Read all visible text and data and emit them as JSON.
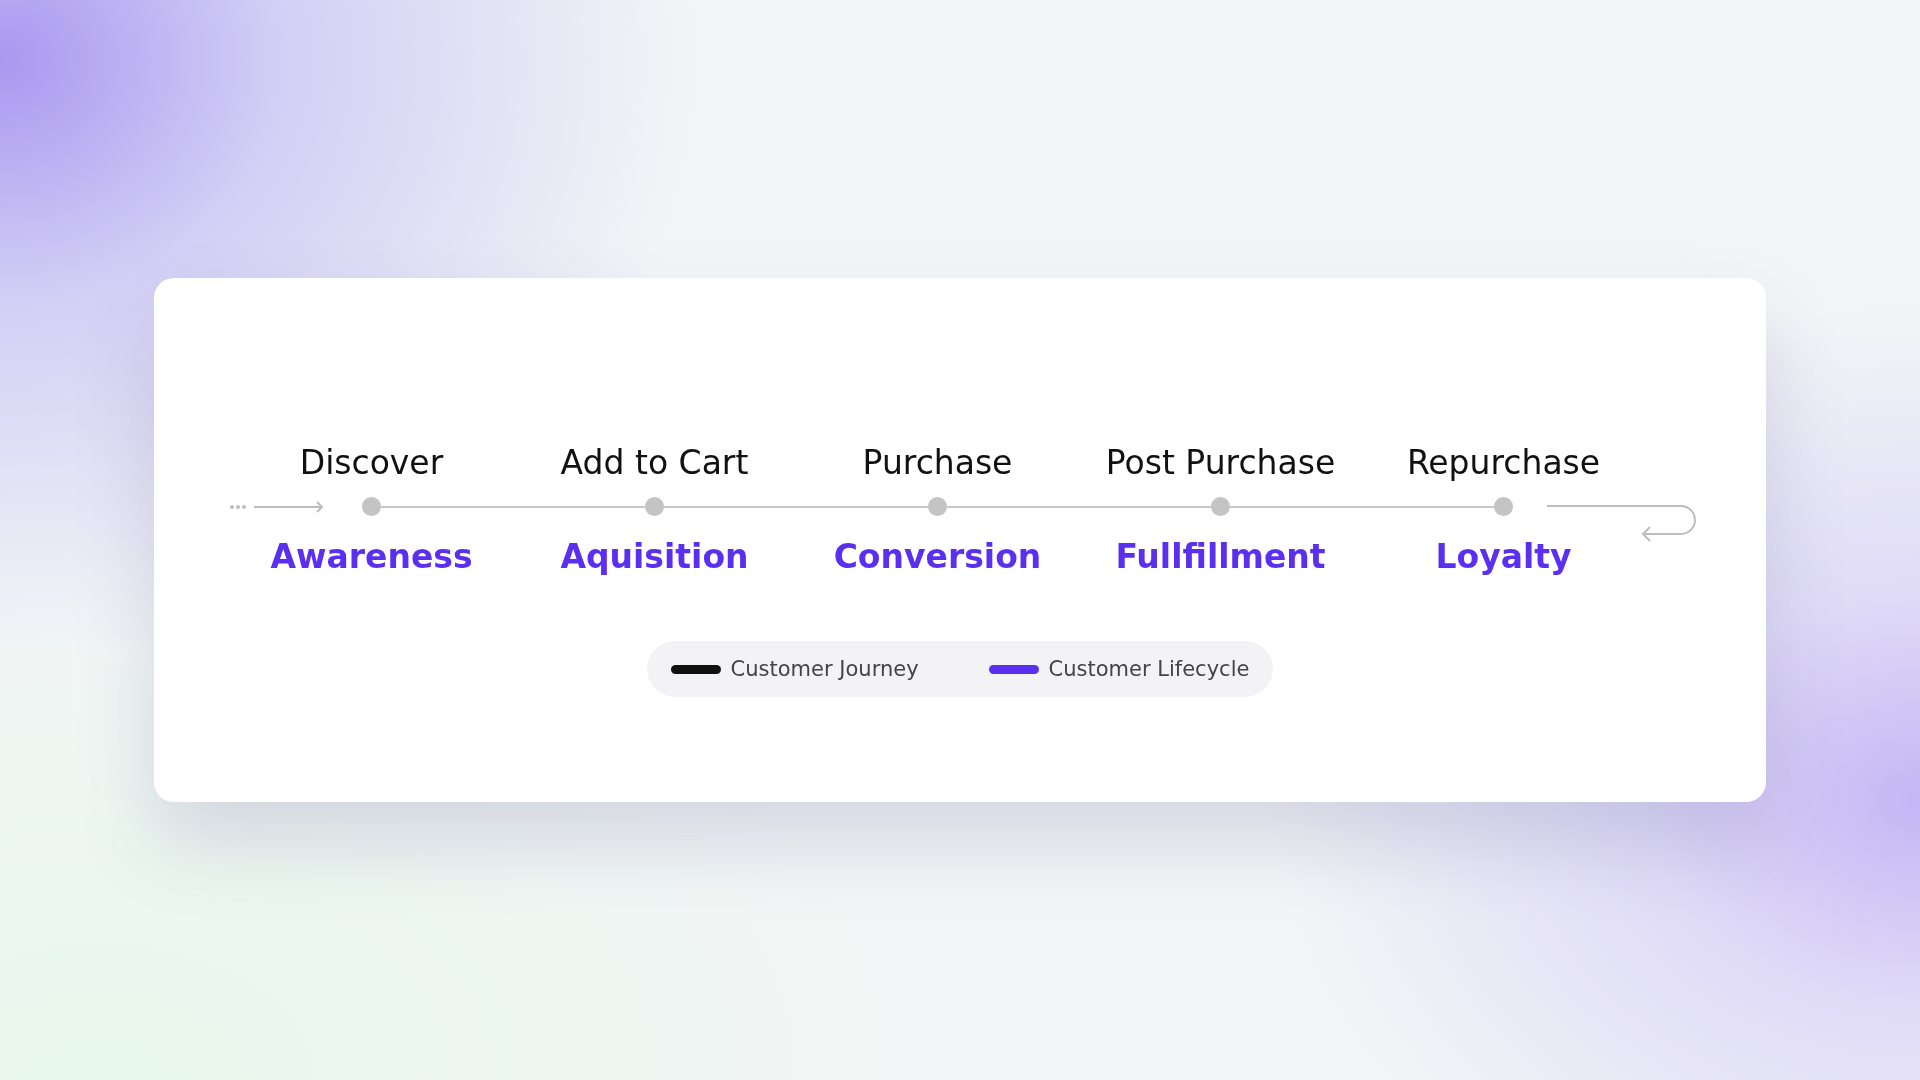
{
  "stages": [
    {
      "journey": "Discover",
      "lifecycle": "Awareness"
    },
    {
      "journey": "Add to Cart",
      "lifecycle": "Aquisition"
    },
    {
      "journey": "Purchase",
      "lifecycle": "Conversion"
    },
    {
      "journey": "Post Purchase",
      "lifecycle": "Fullfillment"
    },
    {
      "journey": "Repurchase",
      "lifecycle": "Loyalty"
    }
  ],
  "legend": [
    {
      "label": "Customer Journey",
      "color": "#111111"
    },
    {
      "label": "Customer Lifecycle",
      "color": "#5b2ff0"
    }
  ]
}
